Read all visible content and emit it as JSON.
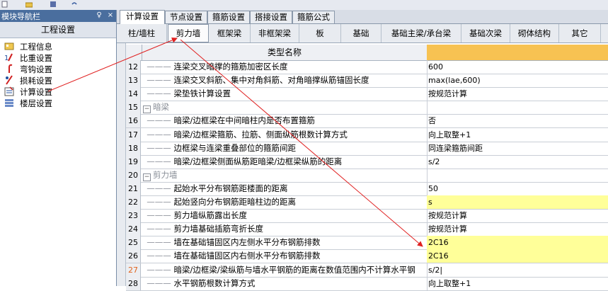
{
  "nav_panel": {
    "title": "模块导航栏",
    "pin_glyph": "♀",
    "close_glyph": "×",
    "header": "工程设置",
    "items": [
      {
        "label": "工程信息",
        "icon": "folder-info-icon",
        "selected": false
      },
      {
        "label": "比重设置",
        "icon": "ratio-icon",
        "selected": false
      },
      {
        "label": "弯钩设置",
        "icon": "hook-icon",
        "selected": false
      },
      {
        "label": "损耗设置",
        "icon": "loss-icon",
        "selected": false
      },
      {
        "label": "计算设置",
        "icon": "calc-settings-icon",
        "selected": true
      },
      {
        "label": "楼层设置",
        "icon": "floor-icon",
        "selected": false
      }
    ]
  },
  "tabs": [
    {
      "label": "计算设置",
      "active": true
    },
    {
      "label": "节点设置",
      "active": false
    },
    {
      "label": "箍筋设置",
      "active": false
    },
    {
      "label": "搭接设置",
      "active": false
    },
    {
      "label": "箍筋公式",
      "active": false
    }
  ],
  "sub_tabs": [
    {
      "label": "柱/墙柱",
      "active": false
    },
    {
      "label": "剪力墙",
      "active": true
    },
    {
      "label": "框架梁",
      "active": false
    },
    {
      "label": "非框架梁",
      "active": false
    },
    {
      "label": "板",
      "active": false
    },
    {
      "label": "基础",
      "active": false
    },
    {
      "label": "基础主梁/承台梁",
      "active": false
    },
    {
      "label": "基础次梁",
      "active": false
    },
    {
      "label": "砌体结构",
      "active": false
    },
    {
      "label": "其它",
      "active": false
    }
  ],
  "grid": {
    "header": "类型名称",
    "rows": [
      {
        "num": "12",
        "name": "连梁交叉暗撑的箍筋加密区长度",
        "value": "600"
      },
      {
        "num": "13",
        "name": "连梁交叉斜筋、集中对角斜筋、对角暗撑纵筋锚固长度",
        "value": "max(lae,600)"
      },
      {
        "num": "14",
        "name": "梁垫铁计算设置",
        "value": "按规范计算"
      },
      {
        "num": "15",
        "name": "暗梁",
        "value": "",
        "section": true,
        "toggle": "−"
      },
      {
        "num": "16",
        "name": "暗梁/边框梁在中间暗柱内是否布置箍筋",
        "value": "否"
      },
      {
        "num": "17",
        "name": "暗梁/边框梁箍筋、拉筋、侧面纵筋根数计算方式",
        "value": "向上取整+1"
      },
      {
        "num": "18",
        "name": "边框梁与连梁重叠部位的箍筋间距",
        "value": "同连梁箍筋间距"
      },
      {
        "num": "19",
        "name": "暗梁/边框梁侧面纵筋距暗梁/边框梁纵筋的距离",
        "value": "s/2"
      },
      {
        "num": "20",
        "name": "剪力墙",
        "value": "",
        "section": true,
        "toggle": "−"
      },
      {
        "num": "21",
        "name": "起始水平分布钢筋距楼面的距离",
        "value": "50"
      },
      {
        "num": "22",
        "name": "起始竖向分布钢筋距暗柱边的距离",
        "value": "s",
        "highlight": true
      },
      {
        "num": "23",
        "name": "剪力墙纵筋露出长度",
        "value": "按规范计算"
      },
      {
        "num": "24",
        "name": "剪力墙基础插筋弯折长度",
        "value": "按规范计算"
      },
      {
        "num": "25",
        "name": "墙在基础锚固区内左侧水平分布钢筋排数",
        "value": "2C16",
        "highlight": true
      },
      {
        "num": "26",
        "name": "墙在基础锚固区内右侧水平分布钢筋排数",
        "value": "2C16",
        "highlight": true
      },
      {
        "num": "27",
        "name": "暗梁/边框梁/梁纵筋与墙水平钢筋的距离在数值范围内不计算水平钢",
        "value": "s/2|",
        "current": true
      },
      {
        "num": "28",
        "name": "水平钢筋根数计算方式",
        "value": "向上取整+1"
      }
    ]
  },
  "colors": {
    "nav_header_bg": "#4a6e9e",
    "header_value_bg": "#f7c252",
    "highlight_bg": "#ffff99",
    "annotation_arrow": "#e02020"
  }
}
